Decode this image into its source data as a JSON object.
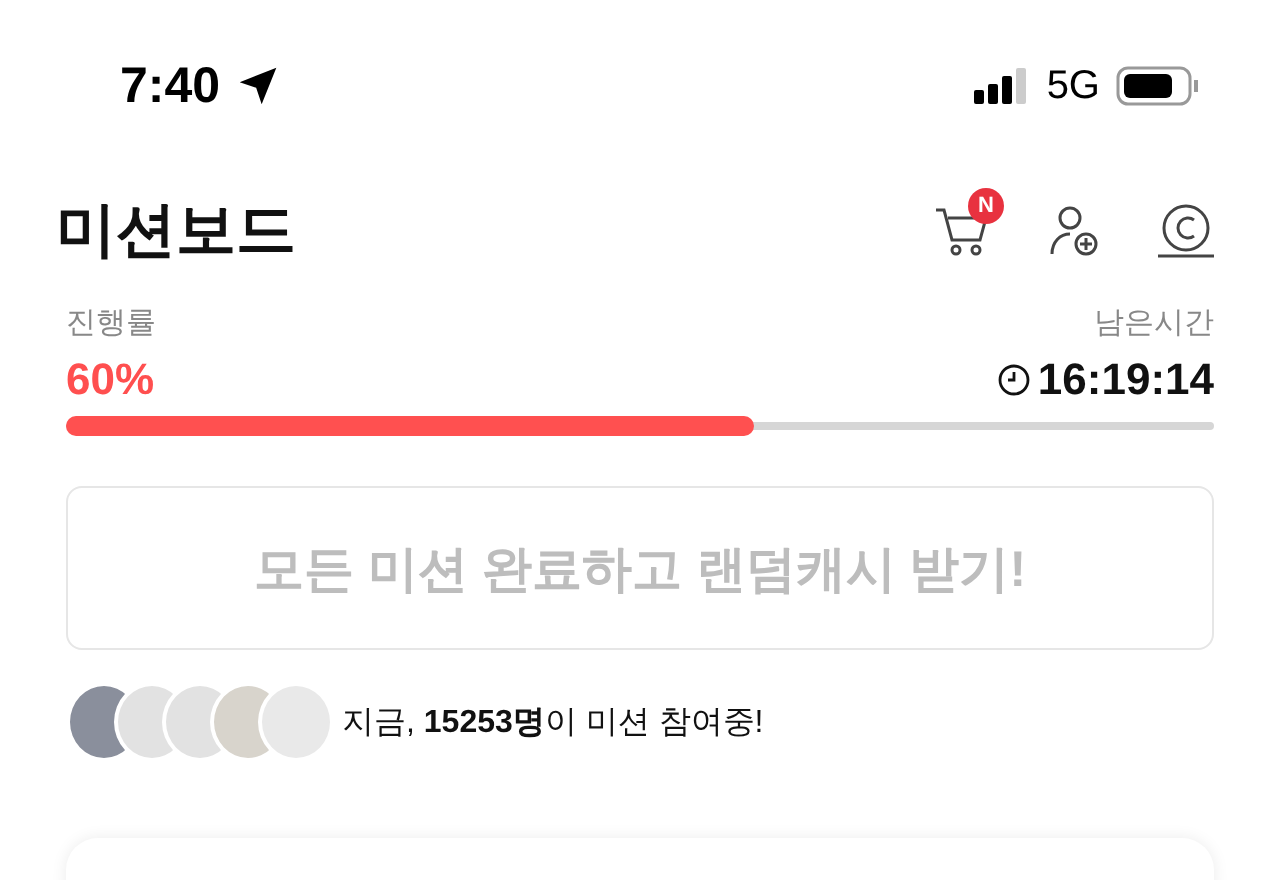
{
  "status_bar": {
    "time": "7:40",
    "network": "5G"
  },
  "header": {
    "title": "미션보드",
    "cart_badge": "N"
  },
  "progress": {
    "label": "진행률",
    "value": "60%",
    "level": 0.6
  },
  "timer": {
    "label": "남은시간",
    "value": "16:19:14"
  },
  "reward_button": {
    "label": "모든 미션 완료하고 랜덤캐시 받기!",
    "disabled": true
  },
  "participants": {
    "text": "지금, **15253명**이 미션 참여중!"
  }
}
